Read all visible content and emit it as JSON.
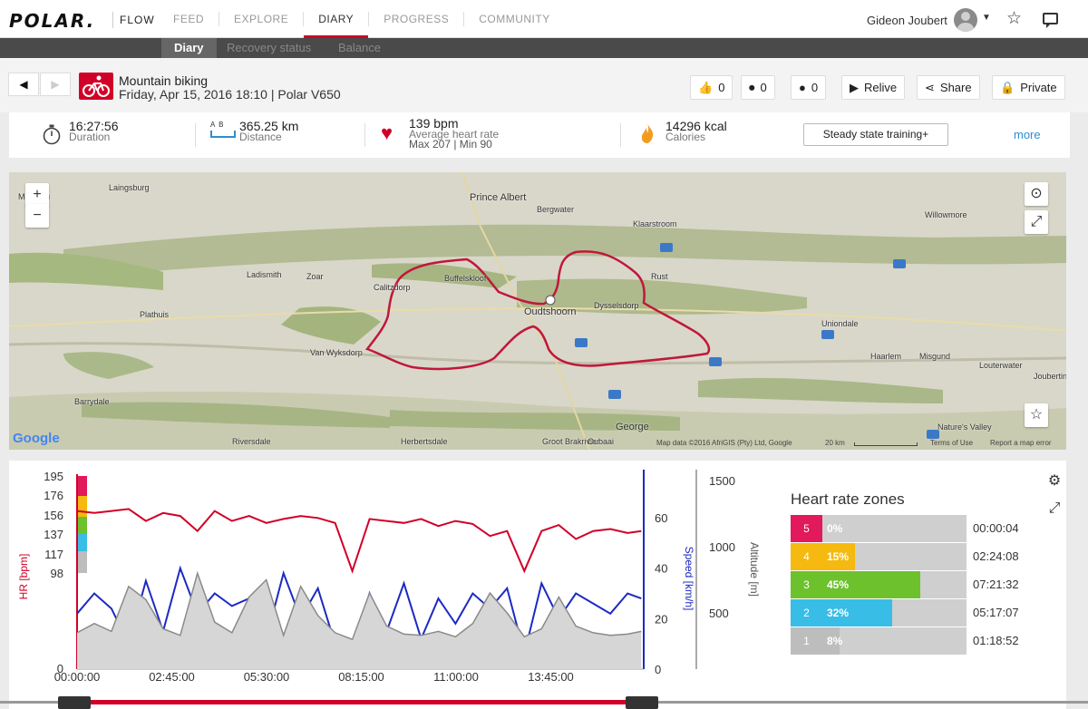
{
  "header": {
    "logo": "POLAR.",
    "flow": "FLOW",
    "nav": [
      "FEED",
      "EXPLORE",
      "DIARY",
      "PROGRESS",
      "COMMUNITY"
    ],
    "active_nav": "DIARY",
    "user": "Gideon Joubert"
  },
  "subnav": {
    "items": [
      "Diary",
      "Recovery status",
      "Balance"
    ],
    "active": "Diary"
  },
  "session": {
    "sport": "Mountain biking",
    "datetime": "Friday, Apr 15, 2016 18:10 | Polar V650"
  },
  "actions": {
    "likes": "0",
    "comments": "0",
    "messages": "0",
    "relive": "Relive",
    "share": "Share",
    "private": "Private"
  },
  "stats": {
    "duration": {
      "value": "16:27:56",
      "label": "Duration"
    },
    "distance": {
      "value": "365.25 km",
      "label": "Distance",
      "icon_text": "A  B"
    },
    "heart_rate": {
      "value": "139 bpm",
      "label": "Average heart rate",
      "sub": "Max 207  |  Min 90"
    },
    "calories": {
      "value": "14296 kcal",
      "label": "Calories"
    },
    "training_benefit": "Steady state training+",
    "more": "more"
  },
  "map": {
    "places": [
      "Laingsburg",
      "Prince Albert",
      "Bergwater",
      "Klaarstroom",
      "Willowmore",
      "Ladismith",
      "Zoar",
      "Buffelskloof",
      "Rust",
      "Calitzdorp",
      "Oudtshoorn",
      "Dysselsdorp",
      "Uniondale",
      "Plathuis",
      "Van Wyksdorp",
      "Haarlem",
      "Misgund",
      "Louterwater",
      "Barrydale",
      "George",
      "Nature's Valley",
      "Riversdale",
      "Herbertsdale",
      "Groot Brakrivier",
      "Oubaai",
      "Montagu",
      "Joubertina"
    ],
    "attribution": "Map data ©2016 AfriGIS (Pty) Ltd, Google",
    "scale": "20 km",
    "terms": "Terms of Use",
    "report": "Report a map error",
    "google": "Google"
  },
  "chart_data": {
    "type": "line",
    "title": "",
    "x_ticks": [
      "00:00:00",
      "02:45:00",
      "05:30:00",
      "08:15:00",
      "11:00:00",
      "13:45:00"
    ],
    "x_range_hours": [
      0,
      16.47
    ],
    "hr_axis": {
      "label": "HR [bpm]",
      "ticks": [
        98,
        117,
        137,
        156,
        176,
        195
      ]
    },
    "speed_axis": {
      "label": "Speed [km/h]",
      "ticks": [
        0,
        20,
        40,
        60
      ]
    },
    "altitude_axis": {
      "label": "Altitude [m]",
      "ticks": [
        500,
        1000,
        1500
      ]
    },
    "series": [
      {
        "name": "HR [bpm]",
        "color": "#d10027",
        "hours": [
          0,
          0.5,
          1,
          1.5,
          2,
          2.5,
          3,
          3.5,
          4,
          4.5,
          5,
          5.5,
          6,
          6.5,
          7,
          7.5,
          8,
          8.5,
          9,
          9.5,
          10,
          10.5,
          11,
          11.5,
          12,
          12.5,
          13,
          13.5,
          14,
          14.5,
          15,
          15.5,
          16,
          16.4
        ],
        "values": [
          160,
          158,
          160,
          162,
          150,
          158,
          155,
          140,
          160,
          150,
          155,
          148,
          152,
          155,
          153,
          148,
          100,
          152,
          150,
          148,
          152,
          145,
          150,
          147,
          135,
          140,
          100,
          140,
          146,
          132,
          140,
          142,
          138,
          140
        ]
      },
      {
        "name": "Speed [km/h]",
        "color": "#1c2ac2",
        "hours": [
          0,
          0.5,
          1,
          1.5,
          2,
          2.5,
          3,
          3.5,
          4,
          4.5,
          5,
          5.5,
          6,
          6.5,
          7,
          7.5,
          8,
          8.5,
          9,
          9.5,
          10,
          10.5,
          11,
          11.5,
          12,
          12.5,
          13,
          13.5,
          14,
          14.5,
          15,
          15.5,
          16,
          16.4
        ],
        "values": [
          22,
          30,
          24,
          10,
          35,
          15,
          40,
          22,
          30,
          25,
          28,
          12,
          38,
          20,
          32,
          10,
          5,
          30,
          15,
          34,
          12,
          28,
          18,
          30,
          24,
          32,
          6,
          34,
          20,
          30,
          26,
          22,
          30,
          28
        ]
      },
      {
        "name": "Altitude [m]",
        "color": "#8a8a8a",
        "hours": [
          0,
          0.5,
          1,
          1.5,
          2,
          2.5,
          3,
          3.5,
          4,
          4.5,
          5,
          5.5,
          6,
          6.5,
          7,
          7.5,
          8,
          8.5,
          9,
          9.5,
          10,
          10.5,
          11,
          11.5,
          12,
          12.5,
          13,
          13.5,
          14,
          14.5,
          15,
          15.5,
          16,
          16.4
        ],
        "values": [
          350,
          420,
          360,
          700,
          600,
          380,
          330,
          800,
          430,
          350,
          620,
          750,
          330,
          700,
          480,
          350,
          300,
          650,
          400,
          340,
          330,
          360,
          320,
          420,
          650,
          500,
          320,
          380,
          620,
          400,
          350,
          330,
          340,
          360
        ]
      }
    ]
  },
  "zones": {
    "title": "Heart rate zones",
    "items": [
      {
        "zone": "5",
        "percent": "0%",
        "time": "00:00:04",
        "fraction": 0.0,
        "color": "#e2195a"
      },
      {
        "zone": "4",
        "percent": "15%",
        "time": "02:24:08",
        "fraction": 0.15,
        "color": "#f5b90f"
      },
      {
        "zone": "3",
        "percent": "45%",
        "time": "07:21:32",
        "fraction": 0.45,
        "color": "#6cc12d"
      },
      {
        "zone": "2",
        "percent": "32%",
        "time": "05:17:07",
        "fraction": 0.32,
        "color": "#38bde6"
      },
      {
        "zone": "1",
        "percent": "8%",
        "time": "01:18:52",
        "fraction": 0.08,
        "color": "#bdbdbd"
      }
    ]
  }
}
